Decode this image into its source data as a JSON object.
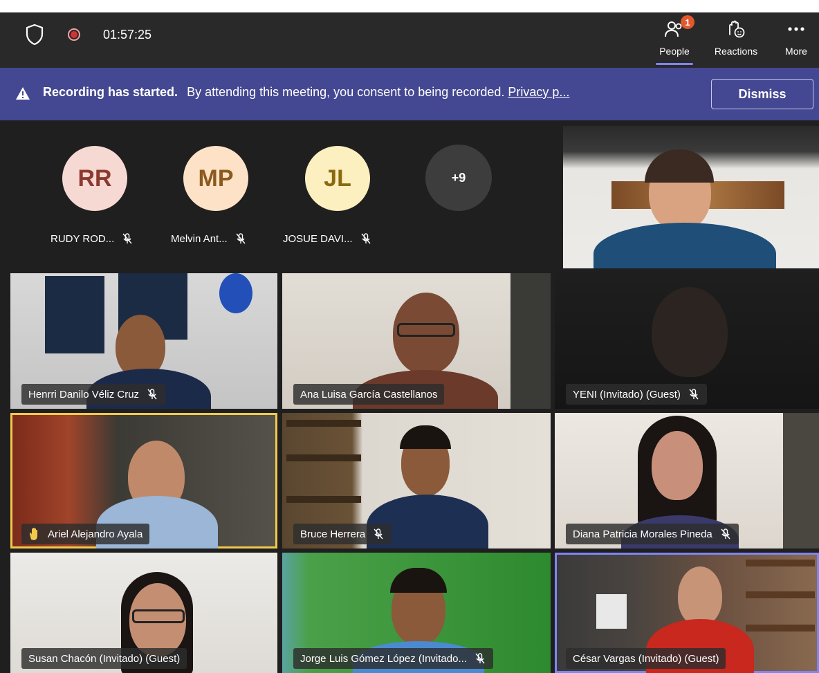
{
  "meeting": {
    "timer": "01:57:25"
  },
  "toolbar": {
    "people": {
      "label": "People",
      "badge": "1",
      "icon": "people-icon"
    },
    "reactions": {
      "label": "Reactions",
      "icon": "reactions-icon"
    },
    "more": {
      "label": "More",
      "icon": "more-icon"
    }
  },
  "banner": {
    "title": "Recording has started.",
    "message": "By attending this meeting, you consent to being recorded.",
    "link": "Privacy p...",
    "dismiss": "Dismiss"
  },
  "avatars": [
    {
      "initials": "RR",
      "name": "RUDY ROD...",
      "bg": "#f7d9d3",
      "fg": "#8a3a2e"
    },
    {
      "initials": "MP",
      "name": "Melvin Ant...",
      "bg": "#fde2c8",
      "fg": "#8a5a1e"
    },
    {
      "initials": "JL",
      "name": "JOSUE DAVI...",
      "bg": "#fdf0c0",
      "fg": "#8a6a10"
    }
  ],
  "overflow": {
    "label": "+9"
  },
  "tiles": [
    {
      "name": "Henrri Danilo Véliz Cruz"
    },
    {
      "name": "Ana Luisa García Castellanos"
    },
    {
      "name": "YENI (Invitado) (Guest)"
    },
    {
      "name": "Ariel Alejandro Ayala"
    },
    {
      "name": "Bruce Herrera"
    },
    {
      "name": "Diana Patricia Morales Pineda"
    },
    {
      "name": "Susan Chacón (Invitado) (Guest)"
    },
    {
      "name": "Jorge Luis Gómez López (Invitado..."
    },
    {
      "name": "César Vargas (Invitado) (Guest)"
    }
  ],
  "colors": {
    "accent": "#7f85f5",
    "banner": "#444791",
    "hand_raised": "#f2c94c",
    "badge": "#e3572d"
  }
}
